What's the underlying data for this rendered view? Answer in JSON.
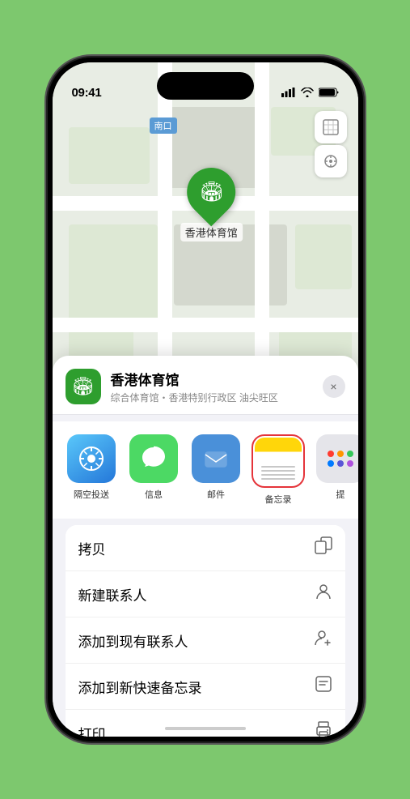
{
  "status_bar": {
    "time": "09:41",
    "signal_icon": "▋▋▋",
    "wifi_icon": "wifi",
    "battery_icon": "battery"
  },
  "map": {
    "road_label": "南口",
    "venue_pin_label": "香港体育馆"
  },
  "sheet": {
    "venue_name": "香港体育馆",
    "venue_subtitle": "综合体育馆・香港特别行政区 油尖旺区",
    "close_label": "×"
  },
  "share_items": [
    {
      "id": "airdrop",
      "label": "隔空投送",
      "type": "airdrop"
    },
    {
      "id": "message",
      "label": "信息",
      "type": "message"
    },
    {
      "id": "mail",
      "label": "邮件",
      "type": "mail"
    },
    {
      "id": "notes",
      "label": "备忘录",
      "type": "notes"
    },
    {
      "id": "more",
      "label": "提",
      "type": "more"
    }
  ],
  "actions": [
    {
      "id": "copy",
      "label": "拷贝",
      "icon": "copy"
    },
    {
      "id": "new-contact",
      "label": "新建联系人",
      "icon": "person"
    },
    {
      "id": "add-existing",
      "label": "添加到现有联系人",
      "icon": "person-add"
    },
    {
      "id": "add-notes",
      "label": "添加到新快速备忘录",
      "icon": "note"
    },
    {
      "id": "print",
      "label": "打印",
      "icon": "printer"
    }
  ],
  "colors": {
    "accent_green": "#2e9e2e",
    "notes_selected": "#e5343a",
    "map_bg": "#e8ede4"
  }
}
